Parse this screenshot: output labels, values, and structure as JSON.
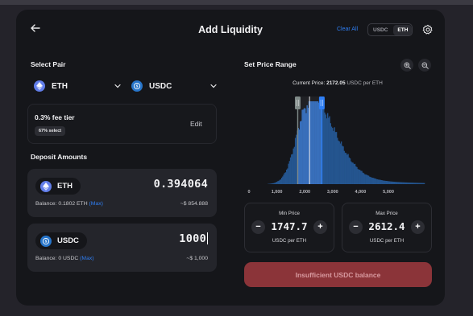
{
  "header": {
    "title": "Add Liquidity",
    "clear_all": "Clear All",
    "currency_toggle": [
      "USDC",
      "ETH"
    ],
    "active_currency": "ETH"
  },
  "pair": {
    "label": "Select Pair",
    "token_a": "ETH",
    "token_b": "USDC"
  },
  "fee": {
    "tier": "0.3% fee tier",
    "select_pct": "67% select",
    "edit": "Edit"
  },
  "deposit": {
    "label": "Deposit Amounts",
    "eth": {
      "token": "ETH",
      "amount": "0.394064",
      "balance_prefix": "Balance: 0.1802 ETH",
      "max": "(Max)",
      "usd": "~$ 854.888"
    },
    "usdc": {
      "token": "USDC",
      "amount": "1000",
      "balance_prefix": "Balance: 0 USDC",
      "max": "(Max)",
      "usd": "~$ 1,000"
    }
  },
  "range": {
    "label": "Set Price Range",
    "current_price_label": "Current Price:",
    "current_price": "2172.05",
    "current_price_unit": "USDC per ETH",
    "min": {
      "label": "Min Price",
      "value": "1747.7",
      "unit": "USDC per ETH"
    },
    "max": {
      "label": "Max Price",
      "value": "2612.4",
      "unit": "USDC per ETH"
    }
  },
  "chart_data": {
    "type": "area",
    "x_ticks": [
      "0",
      "1,000",
      "2,000",
      "3,000",
      "4,000",
      "5,000"
    ],
    "x_range": [
      0,
      6300
    ],
    "current_price": 2172.05,
    "range_min": 1747.7,
    "range_max": 2612.4
  },
  "cta": {
    "label": "Insufficient USDC balance"
  },
  "colors": {
    "accent": "#2f7ff5",
    "chart_fill": "#2e68b8",
    "chart_fill_dim": "#24558f",
    "range_min_handle": "#7f8a88",
    "range_max_handle": "#2f7ff5",
    "cta_bg": "#8b3439"
  }
}
